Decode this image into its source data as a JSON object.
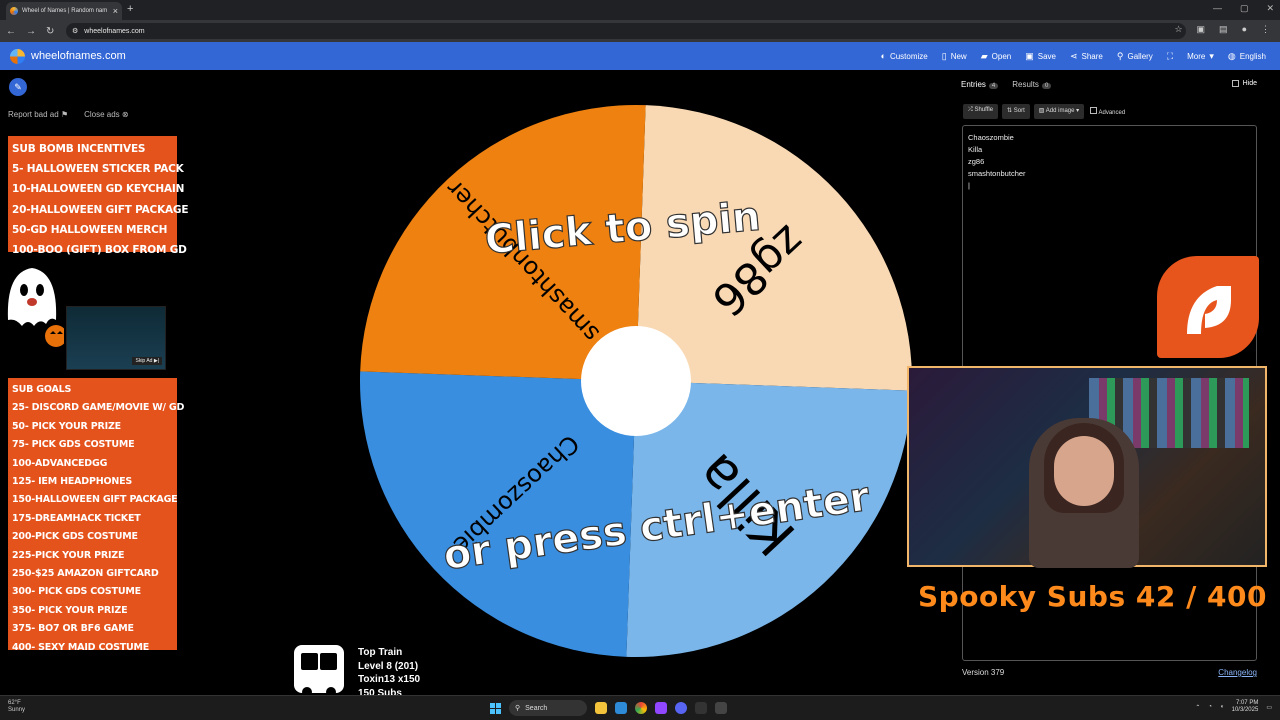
{
  "browser": {
    "tab_title": "Wheel of Names | Random nam",
    "url": "wheelofnames.com"
  },
  "nav": {
    "brand": "wheelofnames.com",
    "items": [
      "Customize",
      "New",
      "Open",
      "Save",
      "Share",
      "Gallery",
      "More",
      "English"
    ]
  },
  "left": {
    "report_ad": "Report bad ad",
    "close_ads": "Close ads",
    "sub_bomb": [
      "SUB BOMB INCENTIVES",
      "5- HALLOWEEN STICKER PACK",
      "10-HALLOWEEN GD KEYCHAIN",
      "20-HALLOWEEN GIFT PACKAGE",
      "50-GD HALLOWEEN MERCH",
      "100-BOO (GIFT) BOX FROM GD"
    ],
    "skip_ad": "Skip Ad",
    "sub_goals": [
      "SUB GOALS",
      "25- DISCORD GAME/MOVIE W/ GD",
      "50- PICK YOUR PRIZE",
      "75- PICK GDS COSTUME",
      "100-ADVANCEDGG",
      "125- IEM HEADPHONES",
      "150-HALLOWEEN GIFT PACKAGE",
      "175-DREAMHACK TICKET",
      "200-PICK GDS COSTUME",
      "225-PICK YOUR PRIZE",
      "250-$25 AMAZON GIFTCARD",
      "300- PICK GDS COSTUME",
      "350- PICK YOUR PRIZE",
      "375- BO7 OR BF6 GAME",
      "400- SEXY MAID COSTUME"
    ]
  },
  "wheel": {
    "segments": [
      {
        "name": "zg86",
        "color": "#f9d9b4"
      },
      {
        "name": "Killa",
        "color": "#7ab6ea"
      },
      {
        "name": "Chaoszombie",
        "color": "#3a8ee0"
      },
      {
        "name": "smashtonbutcher",
        "color": "#ee8110"
      }
    ],
    "spin_line1": "Click to spin",
    "spin_line2": "or press ctrl+enter"
  },
  "right": {
    "tab_entries": "Entries",
    "entries_count": "4",
    "tab_results": "Results",
    "results_count": "0",
    "hide": "Hide",
    "tools": [
      "Shuffle",
      "Sort",
      "Add image",
      "Advanced"
    ],
    "entries": [
      "Chaoszombie",
      "Killa",
      "zg86",
      "smashtonbutcher"
    ],
    "version": "Version 379",
    "changelog": "Changelog"
  },
  "overlay": {
    "spooky": "Spooky Subs  42 / 400",
    "train_title": "Top Train",
    "train_level": "Level 8  (201)",
    "train_user": "Toxin13 x150",
    "train_subs": "150 Subs"
  },
  "taskbar": {
    "temp": "62°F",
    "weather": "Sunny",
    "search": "Search",
    "time": "7:07 PM",
    "date": "10/3/2025"
  }
}
